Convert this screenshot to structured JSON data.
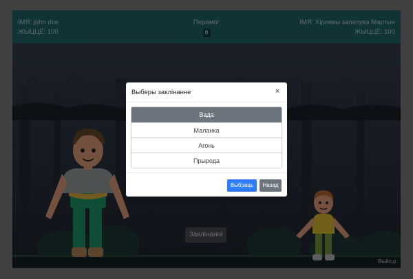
{
  "header": {
    "player_name": "ІМЯ: john doe",
    "player_hp": "ЖЫЦЦЁ: 100",
    "wins_label": "Перамог",
    "wins_count": "0",
    "enemy_name": "ІМЯ: Хірлявы залепука Мартын",
    "enemy_hp": "ЖЫЦЦЁ: 100"
  },
  "arena": {
    "spells_button": "Заклінанні",
    "exit_label": "Выйсці"
  },
  "modal": {
    "title": "Выберы заклінанне",
    "close_symbol": "×",
    "spells": [
      "Вада",
      "Маланка",
      "Агонь",
      "Прырода"
    ],
    "selected_index": 0,
    "select_button": "Выбраць",
    "back_button": "Назад"
  },
  "colors": {
    "status_bar": "#1f6b6f",
    "accent_primary": "#2f7cf6",
    "accent_secondary": "#6c757d"
  }
}
